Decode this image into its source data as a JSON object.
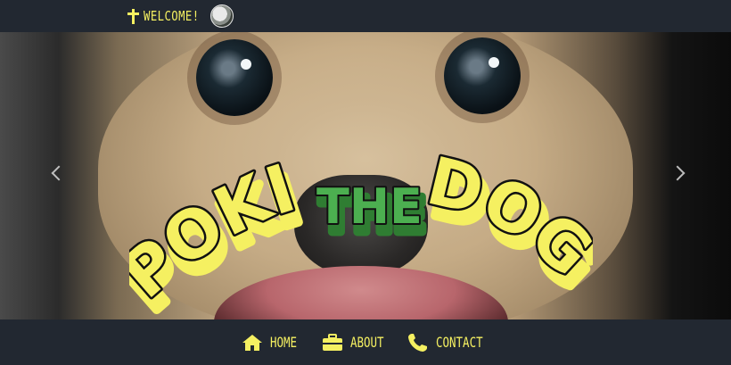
{
  "header": {
    "welcome_label": "WELCOME!",
    "icons": [
      "cross-icon",
      "avatar"
    ]
  },
  "hero": {
    "logo_text": [
      "POKI",
      "THE",
      "DOG"
    ],
    "controls": [
      "previous",
      "next"
    ]
  },
  "nav": {
    "items": [
      {
        "label": "HOME",
        "icon": "home-icon"
      },
      {
        "label": "ABOUT",
        "icon": "briefcase-icon"
      },
      {
        "label": "CONTACT",
        "icon": "phone-icon"
      }
    ]
  },
  "colors": {
    "background": "#222831",
    "accent_yellow": "#f5f061",
    "accent_green": "#4caf50"
  }
}
